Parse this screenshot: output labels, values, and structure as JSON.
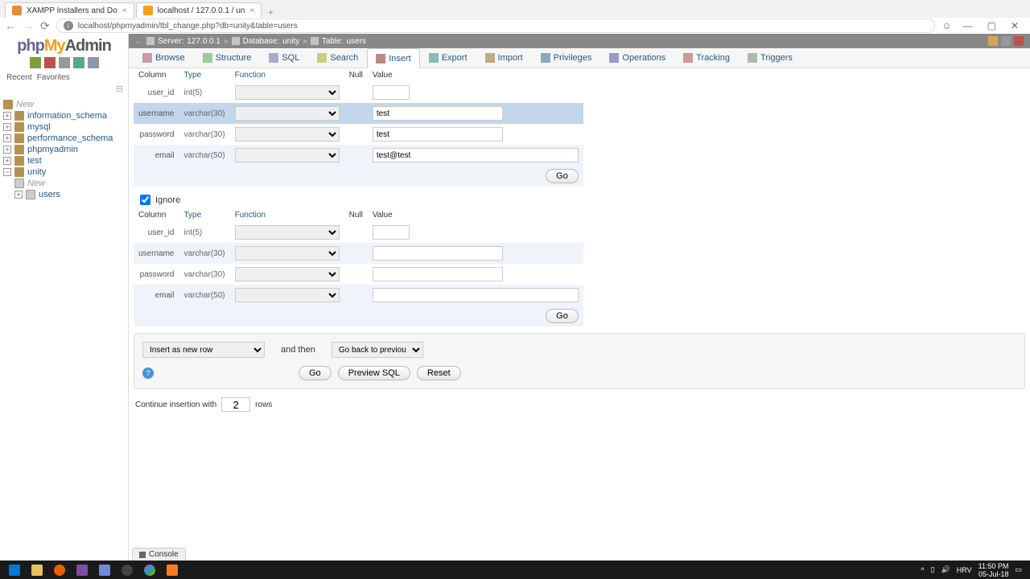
{
  "browser": {
    "tabs": [
      {
        "title": "XAMPP Installers and Do"
      },
      {
        "title": "localhost / 127.0.0.1 / un"
      }
    ],
    "url": "localhost/phpmyadmin/tbl_change.php?db=unity&table=users"
  },
  "logo": {
    "php": "php",
    "my": "My",
    "admin": "Admin"
  },
  "side_tabs": {
    "recent": "Recent",
    "favorites": "Favorites"
  },
  "tree": {
    "new": "New",
    "items": [
      "information_schema",
      "mysql",
      "performance_schema",
      "phpmyadmin",
      "test",
      "unity"
    ],
    "unity_children": {
      "new": "New",
      "users": "users"
    }
  },
  "breadcrumb": {
    "server_label": "Server:",
    "server": "127.0.0.1",
    "db_label": "Database:",
    "db": "unity",
    "table_label": "Table:",
    "table": "users"
  },
  "tabs": {
    "browse": "Browse",
    "structure": "Structure",
    "sql": "SQL",
    "search": "Search",
    "insert": "Insert",
    "export": "Export",
    "import": "Import",
    "privileges": "Privileges",
    "operations": "Operations",
    "tracking": "Tracking",
    "triggers": "Triggers"
  },
  "headers": {
    "column": "Column",
    "type": "Type",
    "function": "Function",
    "null": "Null",
    "value": "Value"
  },
  "rows": [
    {
      "name": "user_id",
      "type": "int(5)",
      "value": "",
      "cls": "short"
    },
    {
      "name": "username",
      "type": "varchar(30)",
      "value": "test",
      "cls": "med",
      "highlight": true
    },
    {
      "name": "password",
      "type": "varchar(30)",
      "value": "test",
      "cls": "med"
    },
    {
      "name": "email",
      "type": "varchar(50)",
      "value": "test@test",
      "cls": "long"
    }
  ],
  "rows2": [
    {
      "name": "user_id",
      "type": "int(5)",
      "cls": "short"
    },
    {
      "name": "username",
      "type": "varchar(30)",
      "cls": "med"
    },
    {
      "name": "password",
      "type": "varchar(30)",
      "cls": "med"
    },
    {
      "name": "email",
      "type": "varchar(50)",
      "cls": "long"
    }
  ],
  "buttons": {
    "go": "Go",
    "preview": "Preview SQL",
    "reset": "Reset"
  },
  "ignore": "Ignore",
  "footer": {
    "insert_mode": "Insert as new row",
    "and_then": "and then",
    "after_action": "Go back to previous page"
  },
  "continue": {
    "pre": "Continue insertion with",
    "value": "2",
    "post": "rows"
  },
  "console": "Console",
  "systray": {
    "lang": "HRV",
    "time": "11:50 PM",
    "date": "05-Jul-18"
  }
}
